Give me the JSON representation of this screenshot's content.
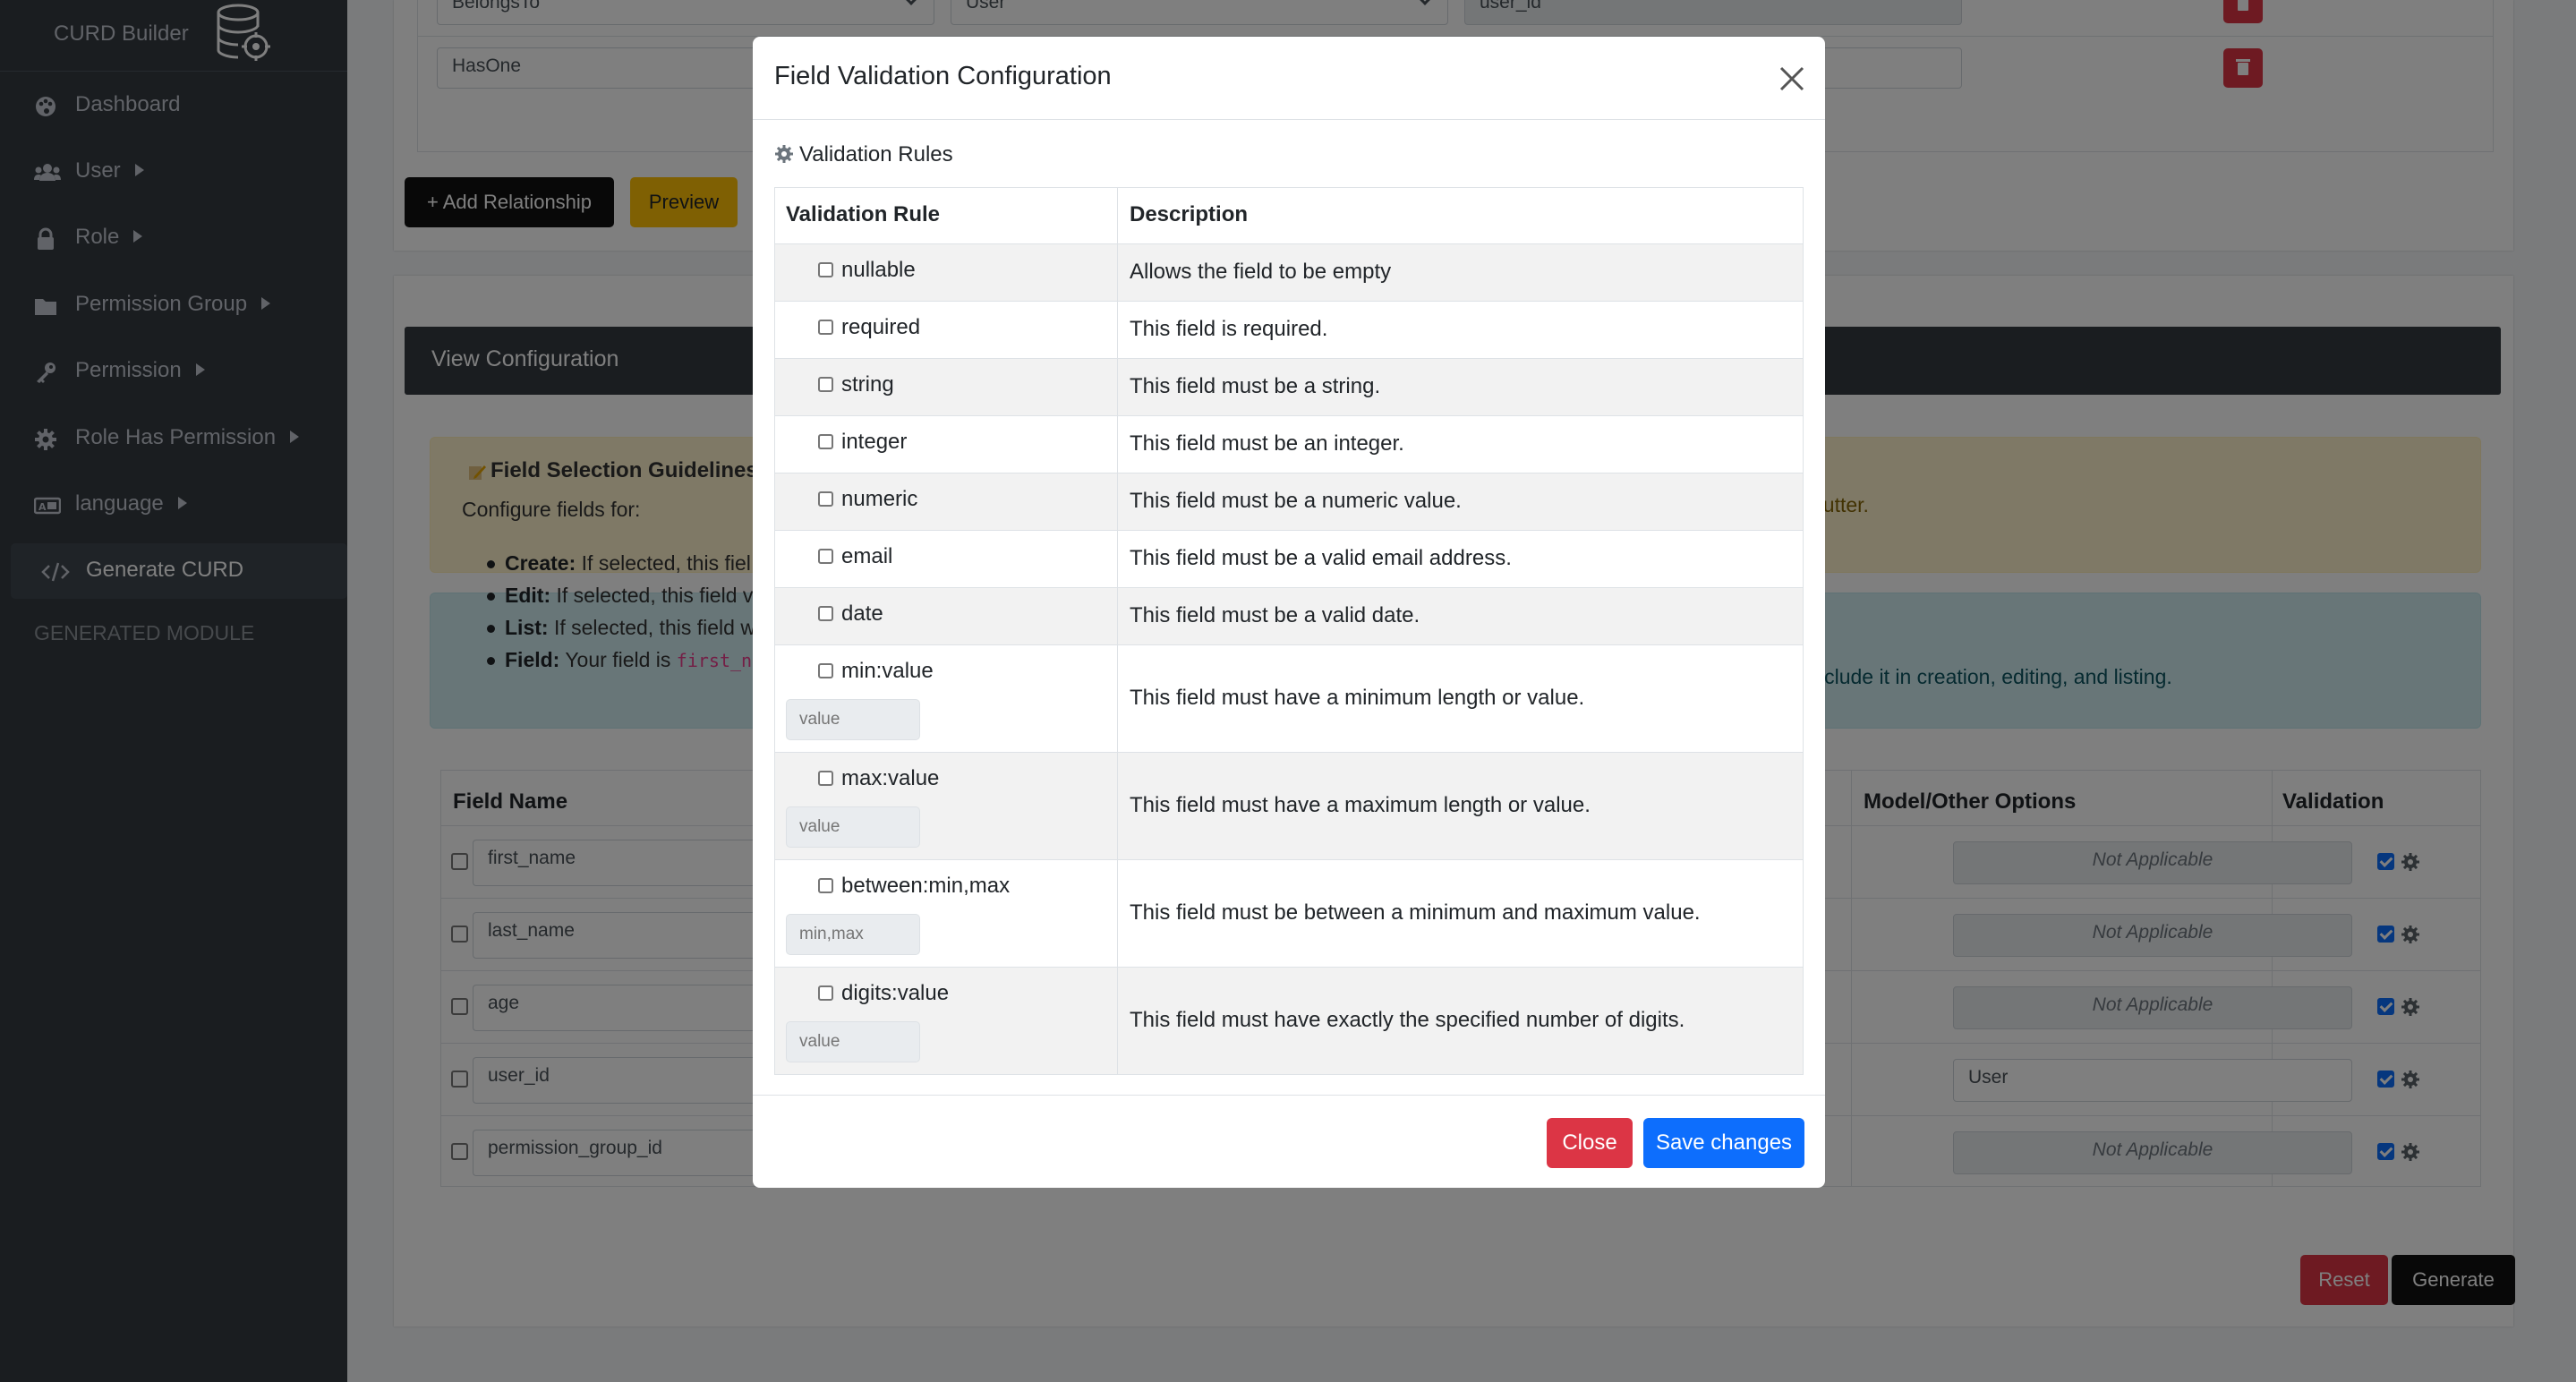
{
  "sidebar": {
    "brand": "CURD Builder",
    "items": [
      {
        "label": "Dashboard",
        "icon": "palette-icon",
        "caret": false
      },
      {
        "label": "User",
        "icon": "users-icon",
        "caret": true
      },
      {
        "label": "Role",
        "icon": "lock-icon",
        "caret": true
      },
      {
        "label": "Permission Group",
        "icon": "folder-icon",
        "caret": true
      },
      {
        "label": "Permission",
        "icon": "key-icon",
        "caret": true
      },
      {
        "label": "Role Has Permission",
        "icon": "gear-icon",
        "caret": true
      },
      {
        "label": "language",
        "icon": "language-icon",
        "caret": true
      },
      {
        "label": "Generate CURD",
        "icon": "code-icon",
        "caret": false
      }
    ],
    "section_header": "GENERATED MODULE"
  },
  "relationships": {
    "rows": [
      {
        "type": "BelongsTo",
        "model": "User",
        "foreign_key": "user_id"
      },
      {
        "type": "HasOne",
        "model": "",
        "foreign_key": ""
      }
    ],
    "add_button": "+ Add Relationship",
    "preview_button": "Preview"
  },
  "view_config": {
    "title": "View Configuration",
    "guide_title": "Field Selection Guidelines",
    "guide_sub": "Configure fields for:",
    "bullets": [
      {
        "key": "Create:",
        "text": "If selected, this fiel"
      },
      {
        "key": "Edit:",
        "text": "If selected, this field v"
      },
      {
        "key": "List:",
        "text": "If selected, this field w"
      },
      {
        "key": "Field:",
        "text": "Your field is",
        "code": "first_n"
      }
    ],
    "warn_text": "d clutter.",
    "info_text": "o include it in creation, editing, and listing.",
    "headers": {
      "field_name": "Field Name",
      "model_options": "Model/Other Options",
      "validation": "Validation"
    },
    "fields": [
      {
        "name": "first_name",
        "option": "Not Applicable"
      },
      {
        "name": "last_name",
        "option": "Not Applicable"
      },
      {
        "name": "age",
        "option": "Not Applicable"
      },
      {
        "name": "user_id",
        "option": "User"
      },
      {
        "name": "permission_group_id",
        "option": "Not Applicable"
      }
    ],
    "reset_button": "Reset",
    "generate_button": "Generate"
  },
  "modal": {
    "title": "Field Validation Configuration",
    "section": "Validation Rules",
    "col_rule": "Validation Rule",
    "col_desc": "Description",
    "rules": [
      {
        "rule": "nullable",
        "desc": "Allows the field to be empty"
      },
      {
        "rule": "required",
        "desc": "This field is required."
      },
      {
        "rule": "string",
        "desc": "This field must be a string."
      },
      {
        "rule": "integer",
        "desc": "This field must be an integer."
      },
      {
        "rule": "numeric",
        "desc": "This field must be a numeric value."
      },
      {
        "rule": "email",
        "desc": "This field must be a valid email address."
      },
      {
        "rule": "date",
        "desc": "This field must be a valid date."
      },
      {
        "rule": "min:value",
        "desc": "This field must have a minimum length or value.",
        "placeholder": "value"
      },
      {
        "rule": "max:value",
        "desc": "This field must have a maximum length or value.",
        "placeholder": "value"
      },
      {
        "rule": "between:min,max",
        "desc": "This field must be between a minimum and maximum value.",
        "placeholder": "min,max"
      },
      {
        "rule": "digits:value",
        "desc": "This field must have exactly the specified number of digits.",
        "placeholder": "value"
      }
    ],
    "close_button": "Close",
    "save_button": "Save changes"
  }
}
